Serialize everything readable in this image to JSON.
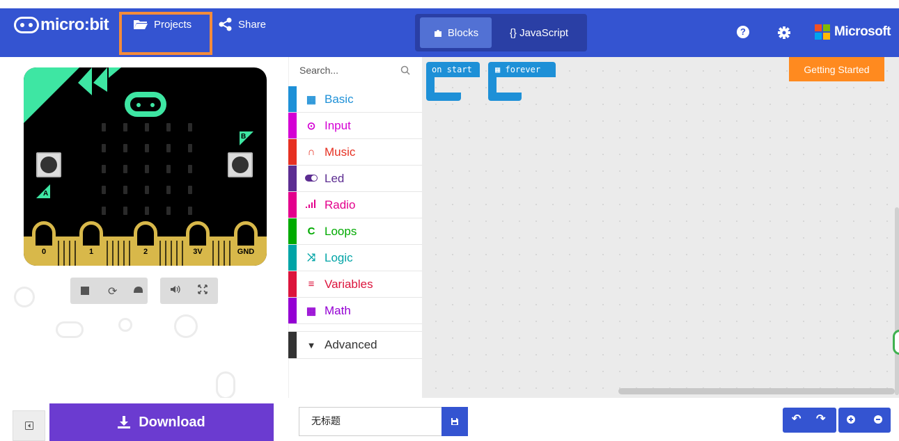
{
  "header": {
    "logo_text": "micro:bit",
    "projects_label": "Projects",
    "share_label": "Share",
    "mode_blocks": "Blocks",
    "mode_js": "{} JavaScript",
    "help_glyph": "?",
    "brand_label": "Microsoft",
    "accent_color": "#3454D1",
    "highlight_color": "#F48B3A"
  },
  "simulator": {
    "pins": [
      "0",
      "1",
      "2",
      "3V",
      "GND"
    ],
    "button_a": "A",
    "button_b": "B",
    "controls": [
      "stop-icon",
      "restart-icon",
      "slow-mo-icon",
      "mute-icon",
      "fullscreen-icon"
    ]
  },
  "toolbox": {
    "search_placeholder": "Search...",
    "categories": [
      {
        "label": "Basic",
        "color": "#1E90D7",
        "icon": "grid-icon"
      },
      {
        "label": "Input",
        "color": "#D400D4",
        "icon": "target-icon"
      },
      {
        "label": "Music",
        "color": "#E63022",
        "icon": "headphones-icon"
      },
      {
        "label": "Led",
        "color": "#5C2D91",
        "icon": "toggle-icon"
      },
      {
        "label": "Radio",
        "color": "#E3008C",
        "icon": "signal-icon"
      },
      {
        "label": "Loops",
        "color": "#00AA00",
        "icon": "loop-icon"
      },
      {
        "label": "Logic",
        "color": "#00A4A6",
        "icon": "shuffle-icon"
      },
      {
        "label": "Variables",
        "color": "#DC143C",
        "icon": "lines-icon"
      },
      {
        "label": "Math",
        "color": "#9400D3",
        "icon": "calculator-icon"
      }
    ],
    "advanced_label": "Advanced"
  },
  "workspace": {
    "block_on_start": "on start",
    "block_forever": "forever",
    "getting_started": "Getting Started"
  },
  "footer": {
    "download_label": "Download",
    "project_name": "无标题"
  }
}
